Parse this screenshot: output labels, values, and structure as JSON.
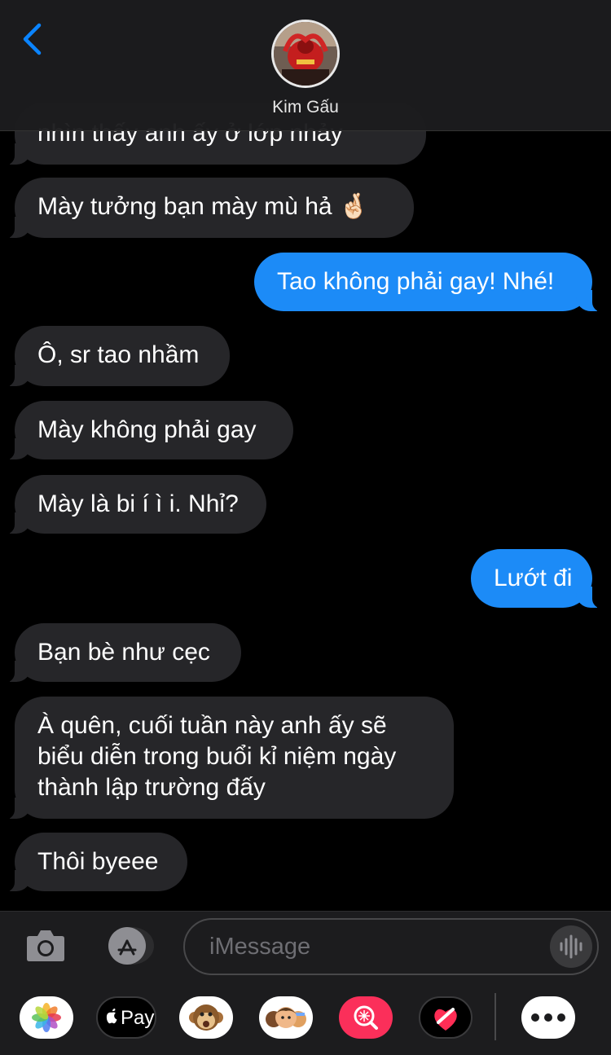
{
  "header": {
    "contact_name": "Kim Gấu"
  },
  "messages": [
    {
      "direction": "incoming",
      "text": "nhìn thấy anh ấy ở lớp nhảy"
    },
    {
      "direction": "incoming",
      "text": "Mày tưởng bạn mày mù hả 🤞🏻"
    },
    {
      "direction": "outgoing",
      "text": "Tao không phải gay! Nhé!"
    },
    {
      "direction": "incoming",
      "text": "Ô, sr tao nhầm"
    },
    {
      "direction": "incoming",
      "text": "Mày không phải gay"
    },
    {
      "direction": "incoming",
      "text": "Mày là bi í ì i. Nhỉ?"
    },
    {
      "direction": "outgoing",
      "text": "Lướt đi"
    },
    {
      "direction": "incoming",
      "text": "Bạn bè như cẹc"
    },
    {
      "direction": "incoming",
      "lines": [
        "À quên, cuối tuần này anh ấy sẽ",
        "biểu diễn trong buổi kỉ niệm ngày",
        "thành lập trường đấy"
      ]
    },
    {
      "direction": "incoming",
      "text": "Thôi byeee"
    }
  ],
  "composer": {
    "placeholder": "iMessage",
    "apple_pay_label": "Pay"
  },
  "app_drawer": [
    "photos-icon",
    "apple-pay-icon",
    "monkey-animoji-icon",
    "memoji-icon",
    "image-search-icon",
    "digital-touch-icon",
    "more-icon"
  ],
  "colors": {
    "incoming_bubble": "#262629",
    "outgoing_bubble": "#1c8bf7",
    "accent": "#0a84ff",
    "background": "#000000"
  }
}
